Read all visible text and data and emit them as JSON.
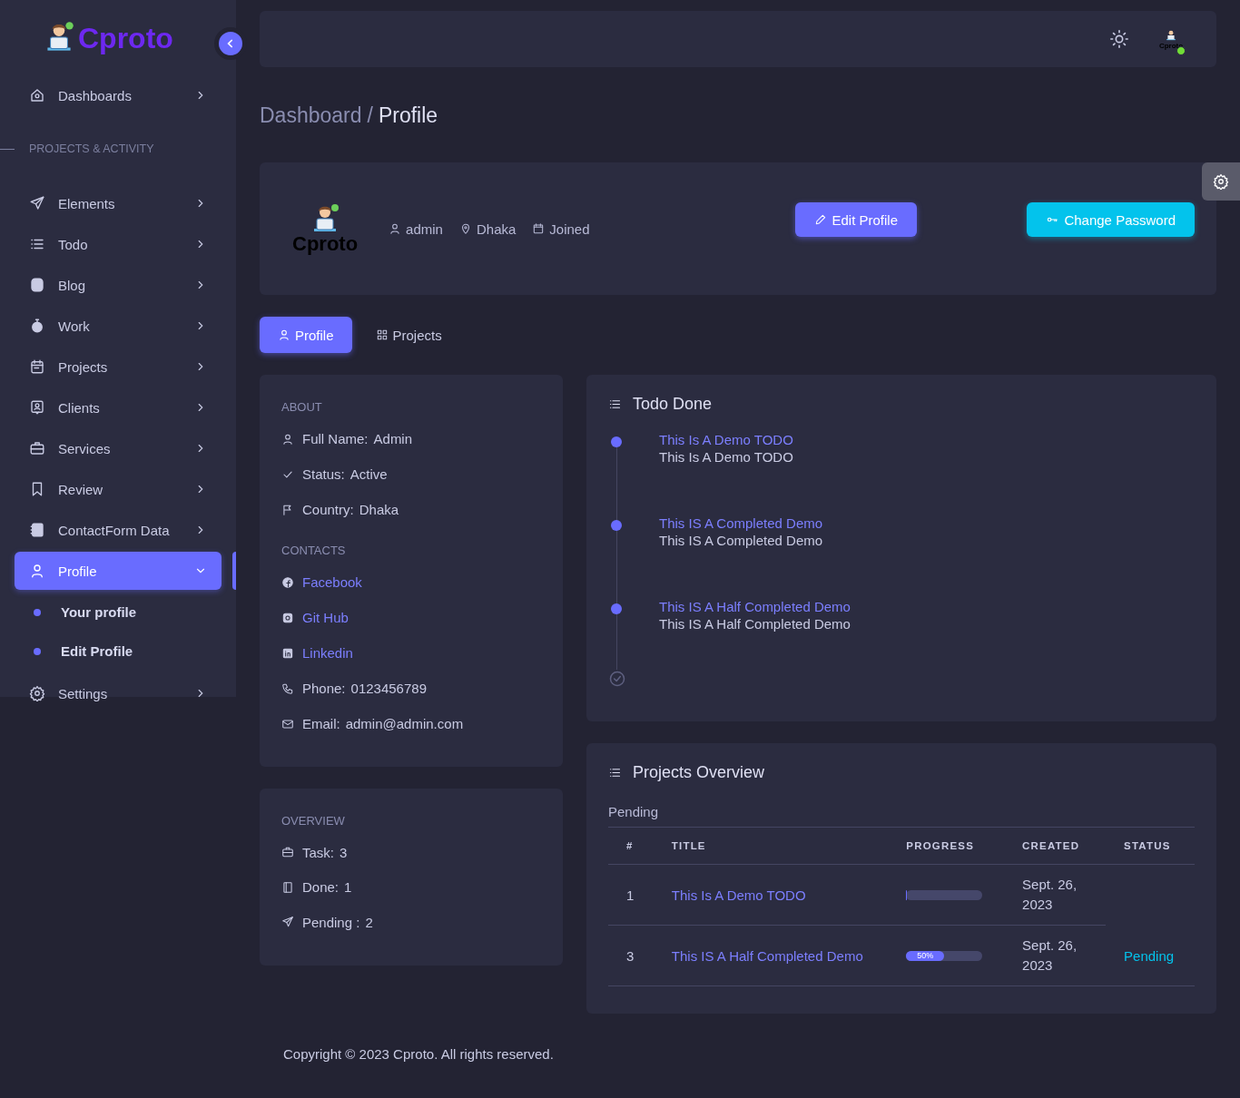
{
  "sidebar": {
    "logo": "Cproto",
    "items": [
      {
        "kind": "item",
        "label": "Dashboards",
        "selected": false,
        "expanded": false
      },
      {
        "kind": "section",
        "label": "PROJECTS & ACTIVITY"
      },
      {
        "kind": "item",
        "label": "Elements",
        "selected": false,
        "expanded": false
      },
      {
        "kind": "item",
        "label": "Todo",
        "selected": false,
        "expanded": false
      },
      {
        "kind": "item",
        "label": "Blog",
        "selected": false,
        "expanded": false
      },
      {
        "kind": "item",
        "label": "Work",
        "selected": false,
        "expanded": false
      },
      {
        "kind": "item",
        "label": "Projects",
        "selected": false,
        "expanded": false
      },
      {
        "kind": "item",
        "label": "Clients",
        "selected": false,
        "expanded": false
      },
      {
        "kind": "item",
        "label": "Services",
        "selected": false,
        "expanded": false
      },
      {
        "kind": "item",
        "label": "Review",
        "selected": false,
        "expanded": false
      },
      {
        "kind": "item",
        "label": "ContactForm Data",
        "selected": false,
        "expanded": false
      },
      {
        "kind": "item",
        "label": "Profile",
        "selected": true,
        "expanded": true,
        "children": [
          {
            "label": "Your profile"
          },
          {
            "label": "Edit Profile"
          }
        ]
      },
      {
        "kind": "item",
        "label": "Settings",
        "selected": false,
        "expanded": false
      }
    ]
  },
  "topbar": {
    "avatar_logo": "Cproto",
    "online": true
  },
  "breadcrumb": {
    "parent": "Dashboard",
    "separator": "/",
    "current": "Profile"
  },
  "profile_card": {
    "logo": "Cproto",
    "meta": [
      "admin",
      "Dhaka",
      "Joined"
    ],
    "buttons": [
      "Edit Profile",
      "Change Password"
    ]
  },
  "tabs": [
    {
      "label": "Profile",
      "selected": true
    },
    {
      "label": "Projects",
      "selected": false
    }
  ],
  "about": {
    "heading": "ABOUT",
    "fields": [
      {
        "label": "Full Name:",
        "value": "Admin"
      },
      {
        "label": "Status:",
        "value": "Active"
      },
      {
        "label": "Country:",
        "value": "Dhaka"
      }
    ]
  },
  "contacts": {
    "heading": "CONTACTS",
    "items": [
      {
        "kind": "link",
        "text": "Facebook"
      },
      {
        "kind": "link",
        "text": "Git Hub"
      },
      {
        "kind": "link",
        "text": "Linkedin"
      },
      {
        "kind": "field",
        "label": "Phone:",
        "value": "0123456789"
      },
      {
        "kind": "field",
        "label": "Email:",
        "value": "admin@admin.com"
      }
    ]
  },
  "overview": {
    "heading": "OVERVIEW",
    "fields": [
      {
        "label": "Task:",
        "value": "3"
      },
      {
        "label": "Done:",
        "value": "1"
      },
      {
        "label": "Pending :",
        "value": "2"
      }
    ]
  },
  "todo_done": {
    "title": "Todo Done",
    "items": [
      {
        "title": "This Is A Demo TODO",
        "text": "This Is A Demo TODO"
      },
      {
        "title": "This IS A Completed Demo",
        "text": "This IS A Completed Demo"
      },
      {
        "title": "This IS A Half Completed Demo",
        "text": "This IS A Half Completed Demo"
      }
    ]
  },
  "projects_overview": {
    "title": "Projects Overview",
    "subtitle": "Pending",
    "columns": [
      "#",
      "TITLE",
      "PROGRESS",
      "CREATED",
      "STATUS"
    ],
    "rows": [
      {
        "num": "1",
        "title": "This Is A Demo TODO",
        "level": 0,
        "created": "Sept. 26, 2023"
      },
      {
        "num": "3",
        "title": "This IS A Half Completed Demo",
        "level": 0.5,
        "reading": "50%",
        "created": "Sept. 26, 2023",
        "status": "Pending"
      }
    ]
  },
  "footer": "Copyright © 2023 Cproto. All rights reserved."
}
